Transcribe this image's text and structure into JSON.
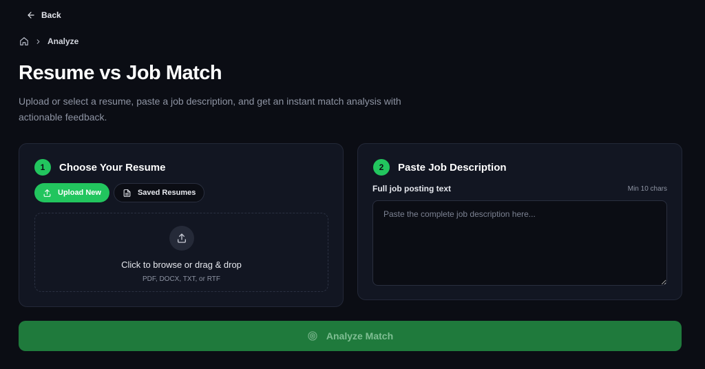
{
  "nav": {
    "back_label": "Back"
  },
  "breadcrumb": {
    "current": "Analyze"
  },
  "header": {
    "title": "Resume vs Job Match",
    "subtitle": "Upload or select a resume, paste a job description, and get an instant match analysis with actionable feedback."
  },
  "resume_card": {
    "step": "1",
    "title": "Choose Your Resume",
    "tabs": [
      {
        "label": "Upload New",
        "icon": "upload-icon",
        "active": true
      },
      {
        "label": "Saved Resumes",
        "icon": "document-icon",
        "active": false
      }
    ],
    "dropzone": {
      "main_text": "Click to browse or drag & drop",
      "formats": "PDF, DOCX, TXT, or RTF"
    }
  },
  "job_card": {
    "step": "2",
    "title": "Paste Job Description",
    "field_label": "Full job posting text",
    "field_hint": "Min 10 chars",
    "placeholder": "Paste the complete job description here...",
    "value": ""
  },
  "actions": {
    "analyze_label": "Analyze Match"
  },
  "colors": {
    "background": "#0b0d14",
    "card": "#121622",
    "accent": "#22c55e",
    "button_disabled": "#1f7a3c"
  }
}
